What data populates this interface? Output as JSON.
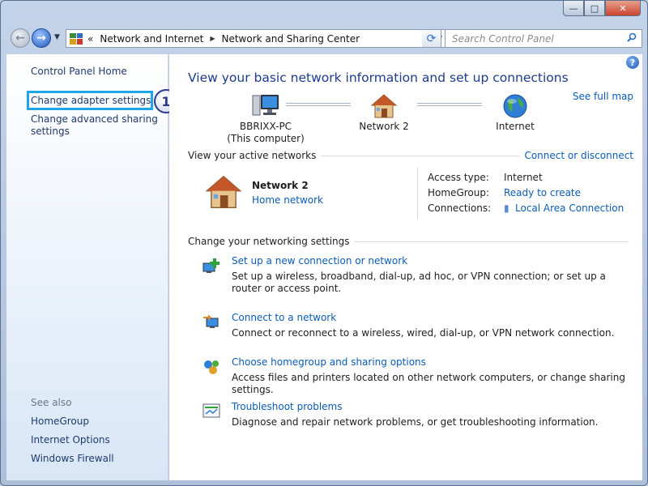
{
  "window": {
    "minimize_glyph": "—",
    "maximize_glyph": "□",
    "close_glyph": "✕"
  },
  "navbar": {
    "back_icon": "back-arrow-icon",
    "forward_icon": "forward-arrow-icon",
    "more_glyph": "«",
    "breadcrumbs": [
      "Network and Internet",
      "Network and Sharing Center"
    ],
    "search_placeholder": "Search Control Panel"
  },
  "sidebar": {
    "home": "Control Panel Home",
    "adapter": "Change adapter settings",
    "advanced": "Change advanced sharing settings",
    "step_number": "1",
    "see_also": "See also",
    "see_also_items": [
      "HomeGroup",
      "Internet Options",
      "Windows Firewall"
    ]
  },
  "main": {
    "help_glyph": "?",
    "heading": "View your basic network information and set up connections",
    "see_full_map": "See full map",
    "map": {
      "computer_name": "BBRIXX-PC",
      "computer_sub": "(This computer)",
      "network": "Network  2",
      "internet": "Internet"
    },
    "active_label": "View your active networks",
    "connect_link": "Connect or disconnect",
    "active_network": {
      "name": "Network  2",
      "type": "Home network",
      "props": [
        {
          "key": "Access type:",
          "value": "Internet"
        },
        {
          "key": "HomeGroup:",
          "value": "Ready to create"
        },
        {
          "key": "Connections:",
          "value": "Local Area Connection"
        }
      ]
    },
    "change_label": "Change your networking settings",
    "tasks": [
      {
        "title": "Set up a new connection or network",
        "desc": "Set up a wireless, broadband, dial-up, ad hoc, or VPN connection; or set up a router or access point."
      },
      {
        "title": "Connect to a network",
        "desc": "Connect or reconnect to a wireless, wired, dial-up, or VPN network connection."
      },
      {
        "title": "Choose homegroup and sharing options",
        "desc": "Access files and printers located on other network computers, or change sharing settings."
      },
      {
        "title": "Troubleshoot problems",
        "desc": "Diagnose and repair network problems, or get troubleshooting information."
      }
    ]
  },
  "colors": {
    "link": "#0b5bb5",
    "heading": "#1e3a8c",
    "highlight": "#1ea6e6"
  }
}
